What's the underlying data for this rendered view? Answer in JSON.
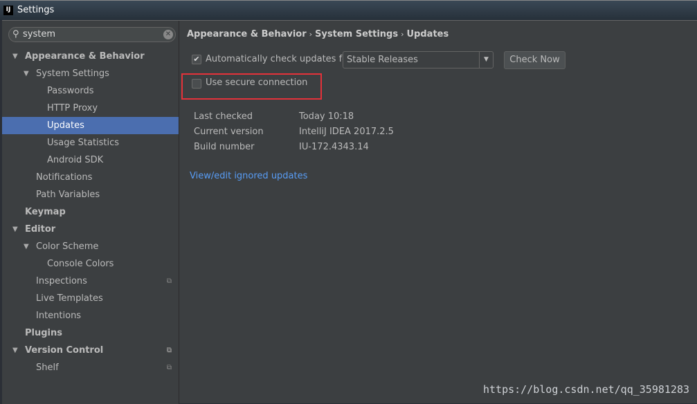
{
  "window": {
    "logo": "IJ",
    "title": "Settings"
  },
  "search": {
    "value": "system"
  },
  "tree": [
    {
      "label": "Appearance & Behavior",
      "level": 0,
      "bold": true,
      "expanded": true
    },
    {
      "label": "System Settings",
      "level": 1,
      "expanded": true
    },
    {
      "label": "Passwords",
      "level": 2
    },
    {
      "label": "HTTP Proxy",
      "level": 2
    },
    {
      "label": "Updates",
      "level": 2,
      "selected": true
    },
    {
      "label": "Usage Statistics",
      "level": 2
    },
    {
      "label": "Android SDK",
      "level": 2
    },
    {
      "label": "Notifications",
      "level": 1
    },
    {
      "label": "Path Variables",
      "level": 1
    },
    {
      "label": "Keymap",
      "level": 0,
      "bold": true
    },
    {
      "label": "Editor",
      "level": 0,
      "bold": true,
      "expanded": true
    },
    {
      "label": "Color Scheme",
      "level": 1,
      "expanded": true
    },
    {
      "label": "Console Colors",
      "level": 2
    },
    {
      "label": "Inspections",
      "level": 1,
      "project": true
    },
    {
      "label": "Live Templates",
      "level": 1
    },
    {
      "label": "Intentions",
      "level": 1
    },
    {
      "label": "Plugins",
      "level": 0,
      "bold": true
    },
    {
      "label": "Version Control",
      "level": 0,
      "bold": true,
      "expanded": true,
      "project": true
    },
    {
      "label": "Shelf",
      "level": 1,
      "project": true
    }
  ],
  "breadcrumb": [
    "Appearance & Behavior",
    "System Settings",
    "Updates"
  ],
  "auto_check": {
    "label": "Automatically check updates for",
    "checked": true
  },
  "channel": {
    "value": "Stable Releases"
  },
  "check_now": "Check Now",
  "secure": {
    "label": "Use secure connection",
    "checked": false
  },
  "info": [
    {
      "key": "Last checked",
      "value": "Today 10:18"
    },
    {
      "key": "Current version",
      "value": "IntelliJ IDEA 2017.2.5"
    },
    {
      "key": "Build number",
      "value": "IU-172.4343.14"
    }
  ],
  "ignored_link": "View/edit ignored updates",
  "watermark": "https://blog.csdn.net/qq_35981283",
  "colors": {
    "selection": "#4b6eaf",
    "highlight": "#e5323a",
    "link": "#589df6"
  }
}
